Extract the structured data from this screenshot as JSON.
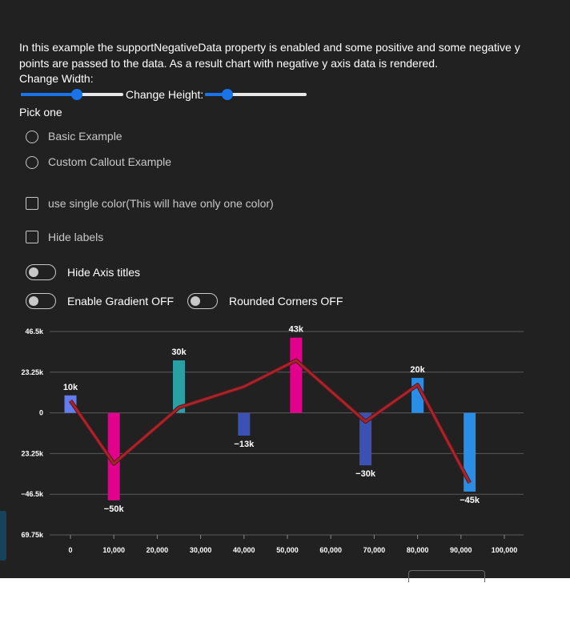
{
  "description": "In this example the supportNegativeData property is enabled and some positive and some negative y points are passed to the data. As a result chart with negative y axis data is rendered.",
  "controls": {
    "change_width_label": "Change Width:",
    "change_height_label": "Change Height:",
    "width_slider_value": 0.55,
    "height_slider_value": 0.22,
    "pick_one_label": "Pick one",
    "radio_options": [
      "Basic Example",
      "Custom Callout Example"
    ],
    "checkbox_single_color": "use single color(This will have only one color)",
    "checkbox_hide_labels": "Hide labels",
    "toggle_hide_axis_titles": "Hide Axis titles",
    "toggle_gradient": "Enable Gradient OFF",
    "toggle_rounded": "Rounded Corners OFF"
  },
  "colors": {
    "background": "#212121",
    "line": "#a4262c",
    "slider_accent": "#1a73e8",
    "bar_colors": [
      "#637cef",
      "#e3008c",
      "#2aa0a4",
      "#3c51b4",
      "#e3008c",
      "#3c51b4",
      "#2a8ee6",
      "#2a8ee6"
    ]
  },
  "chart_data": {
    "type": "bar",
    "x": [
      0,
      10000,
      25000,
      40000,
      52000,
      68000,
      80000,
      92000
    ],
    "values": [
      10000,
      -50000,
      30000,
      -13000,
      43000,
      -30000,
      20000,
      -45000
    ],
    "data_labels": [
      "10k",
      "−50k",
      "30k",
      "−13k",
      "43k",
      "−30k",
      "20k",
      "−45k"
    ],
    "line_values": [
      7000,
      -29000,
      3000,
      15000,
      30000,
      -5000,
      16000,
      -40000
    ],
    "y_ticks": [
      46500,
      23250,
      0,
      -23250,
      -46500,
      -69750
    ],
    "y_tick_labels": [
      "46.5k",
      "23.25k",
      "0",
      "23.25k",
      "−46.5k",
      "69.75k"
    ],
    "x_ticks": [
      0,
      10000,
      20000,
      30000,
      40000,
      50000,
      60000,
      70000,
      80000,
      90000,
      100000
    ],
    "x_tick_labels": [
      "0",
      "10,000",
      "20,000",
      "30,000",
      "40,000",
      "50,000",
      "60,000",
      "70,000",
      "80,000",
      "90,000",
      "100,000"
    ],
    "xlim": [
      0,
      100000
    ],
    "ylim": [
      -69750,
      46500
    ],
    "grid": true
  }
}
